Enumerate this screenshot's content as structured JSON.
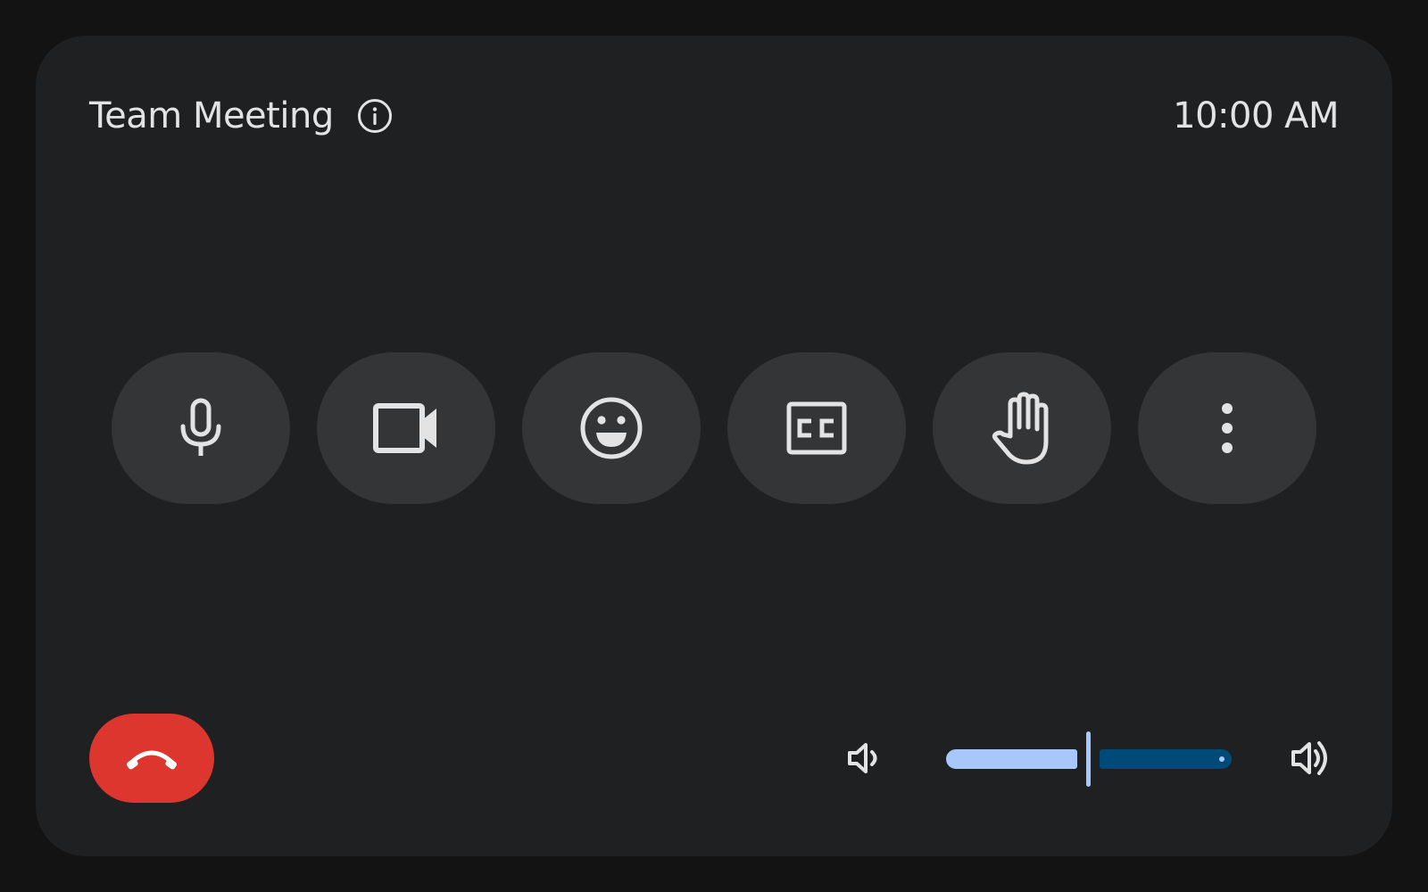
{
  "meeting": {
    "title": "Team Meeting",
    "time": "10:00 AM"
  },
  "icons": {
    "info": "info-icon",
    "mic": "microphone-icon",
    "camera": "videocam-icon",
    "reactions": "emoji-icon",
    "captions": "closed-captions-icon",
    "hand": "raise-hand-icon",
    "more": "more-vert-icon",
    "hangup": "call-end-icon",
    "volume_low": "volume-down-icon",
    "volume_high": "volume-up-icon"
  },
  "volume": {
    "level": 0.5
  },
  "colors": {
    "background": "#131314",
    "card": "#1f2022",
    "control_button": "#333537",
    "hangup": "#dc362e",
    "slider_active": "#a8c7fa",
    "slider_inactive": "#004a77",
    "text": "#e3e3e3"
  }
}
